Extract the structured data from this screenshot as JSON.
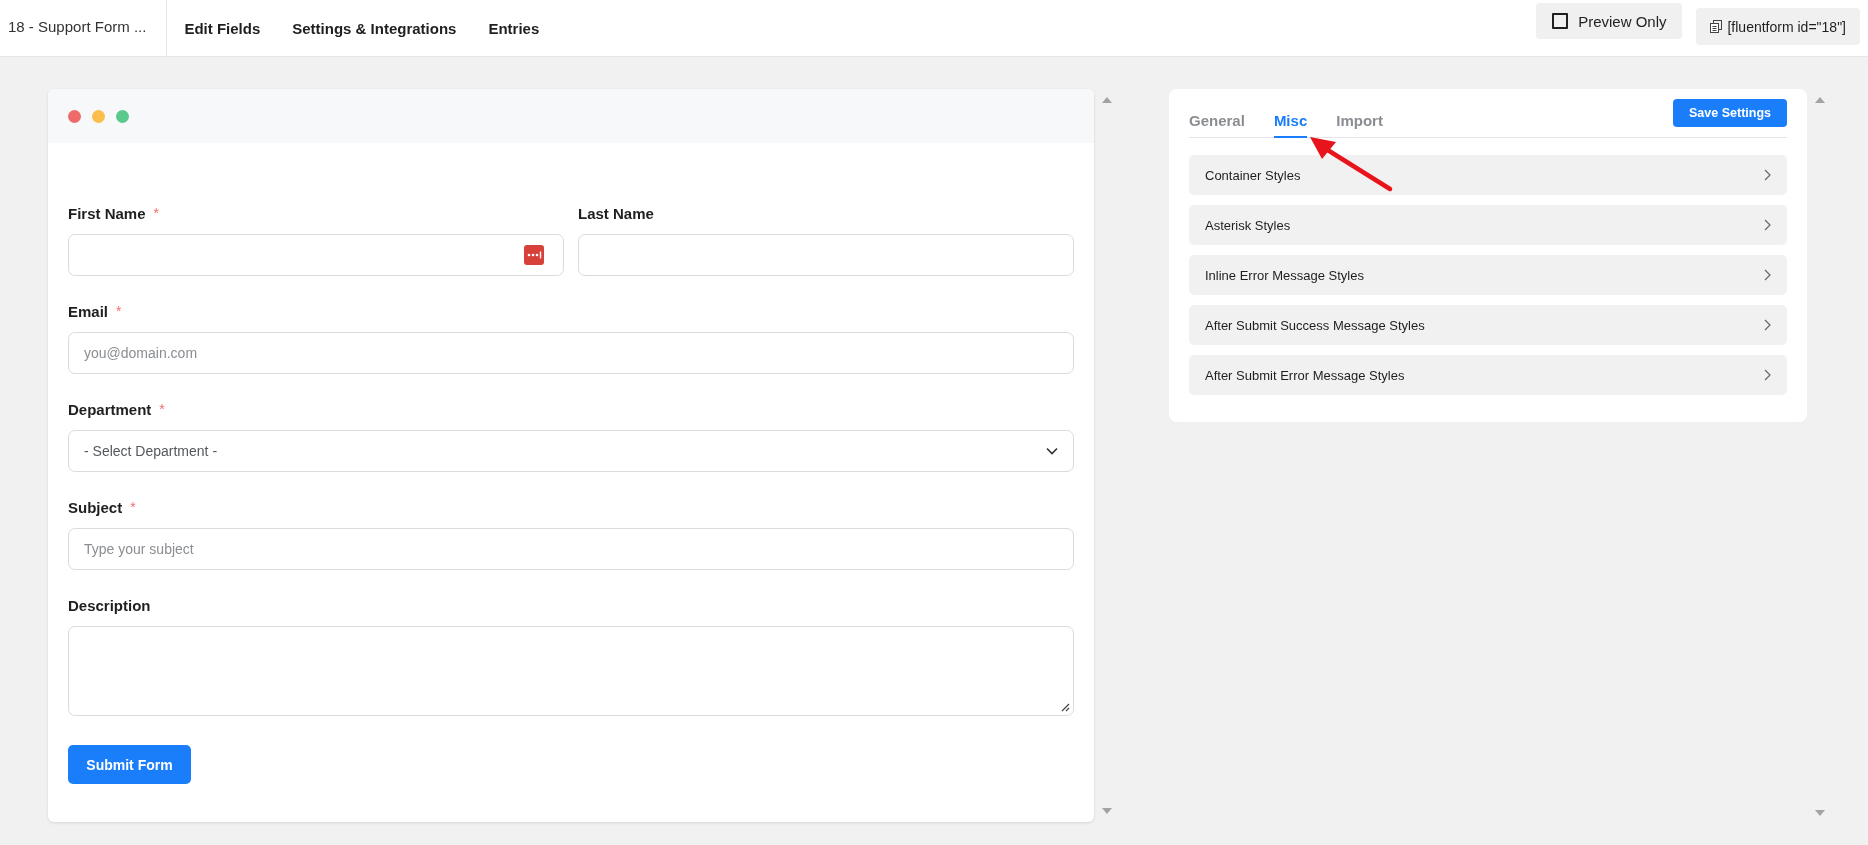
{
  "topbar": {
    "form_title": "18 - Support Form ...",
    "nav": [
      {
        "label": "Edit Fields",
        "selected": false
      },
      {
        "label": "Settings & Integrations",
        "selected": false
      },
      {
        "label": "Entries",
        "selected": false
      }
    ],
    "preview": {
      "label": "Preview Only",
      "checked": false
    },
    "shortcode": "[fluentform id=\"18\"]"
  },
  "form": {
    "rows": [
      {
        "fields": [
          {
            "kind": "text",
            "label": "First Name",
            "asterisk": "*",
            "password_manager_icon": true
          },
          {
            "kind": "text",
            "label": "Last Name"
          }
        ]
      },
      {
        "fields": [
          {
            "kind": "text",
            "label": "Email",
            "asterisk": "*",
            "placeholder": "you@domain.com"
          }
        ]
      },
      {
        "fields": [
          {
            "kind": "select",
            "label": "Department",
            "asterisk": "*",
            "value": "- Select Department -"
          }
        ]
      },
      {
        "fields": [
          {
            "kind": "text",
            "label": "Subject",
            "asterisk": "*",
            "placeholder": "Type your subject"
          }
        ]
      },
      {
        "fields": [
          {
            "kind": "textarea",
            "label": "Description"
          }
        ]
      }
    ],
    "submit": "Submit Form"
  },
  "settings": {
    "tabs": [
      {
        "label": "General",
        "selected": false
      },
      {
        "label": "Misc",
        "selected": true
      },
      {
        "label": "Import",
        "selected": false
      }
    ],
    "save": "Save Settings",
    "sections": [
      {
        "label": "Container Styles",
        "expanded": false
      },
      {
        "label": "Asterisk Styles",
        "expanded": false
      },
      {
        "label": "Inline Error Message Styles",
        "expanded": false
      },
      {
        "label": "After Submit Success Message Styles",
        "expanded": false
      },
      {
        "label": "After Submit Error Message Styles",
        "expanded": false
      }
    ]
  }
}
